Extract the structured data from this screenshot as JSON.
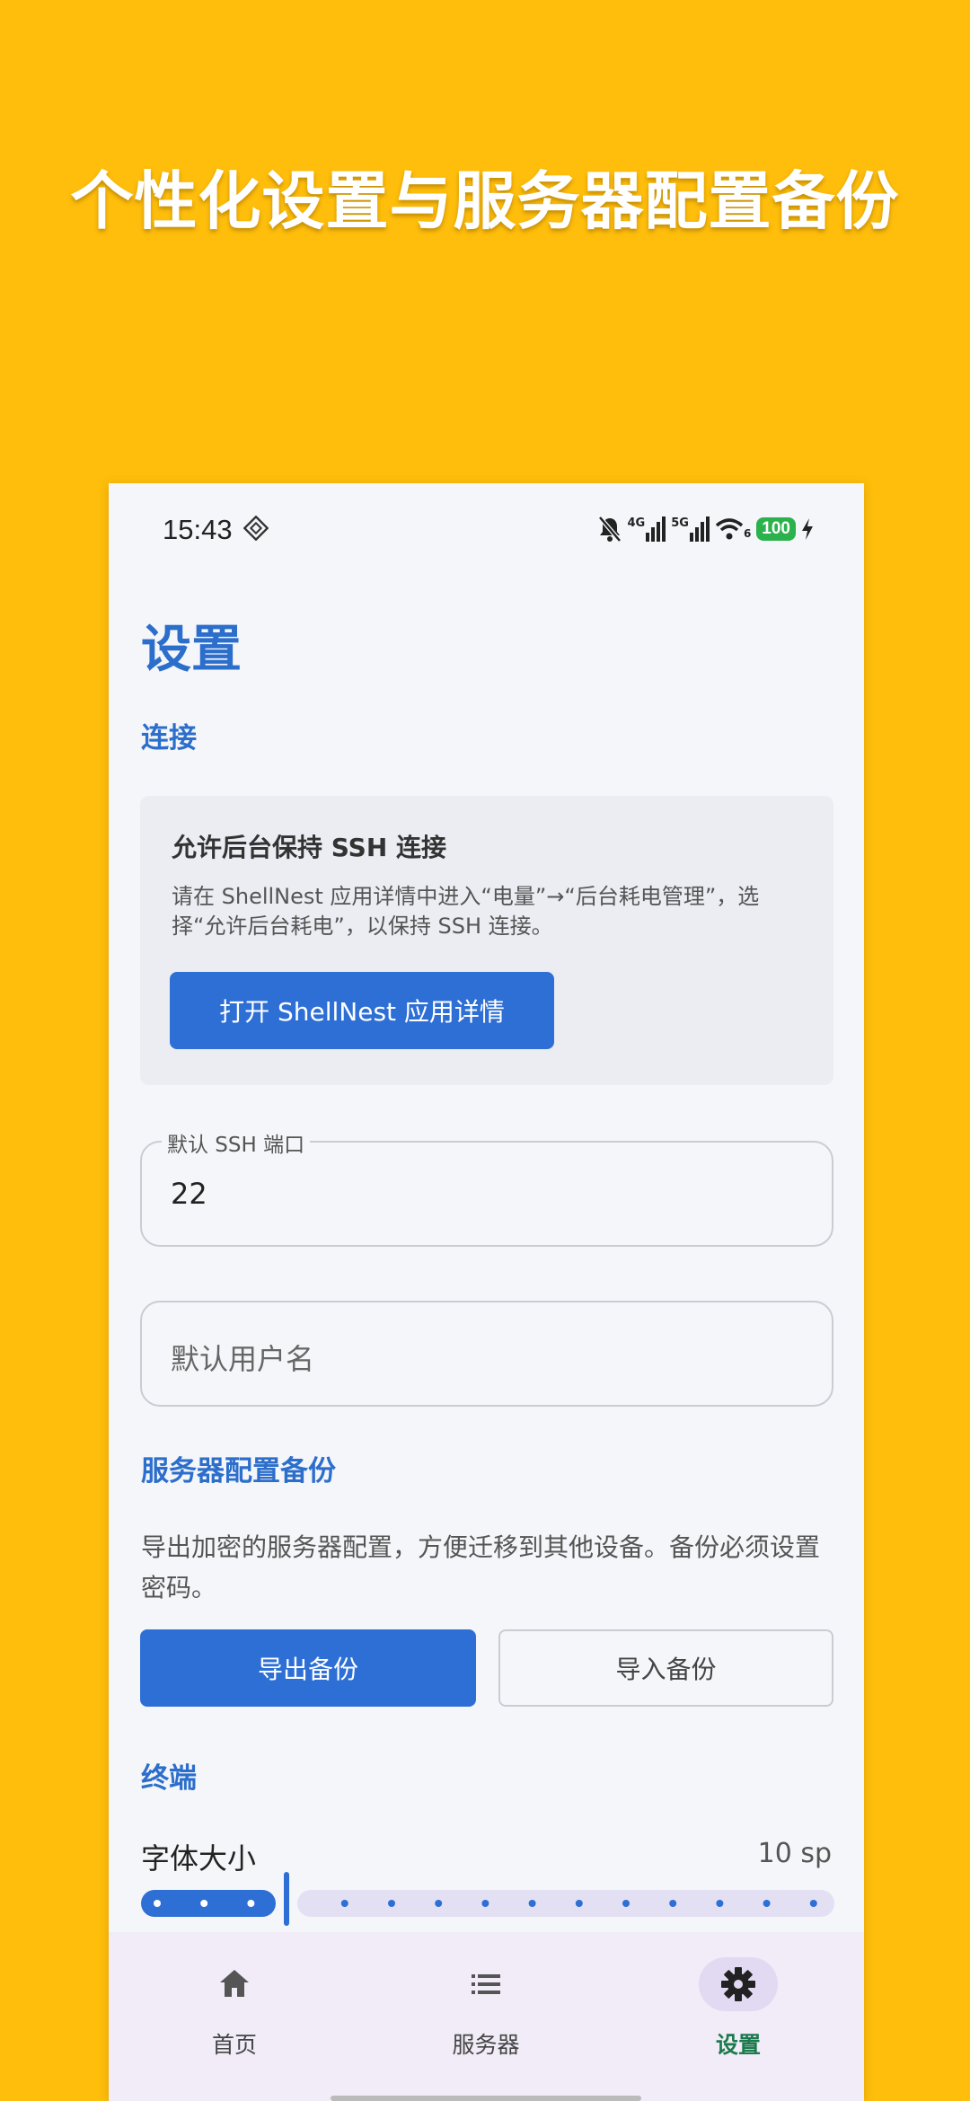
{
  "headline": "个性化设置与服务器配置备份",
  "status_bar": {
    "time": "15:43",
    "network_4g": "4G",
    "network_5g": "5G",
    "wifi_num": "6",
    "battery": "100"
  },
  "page_title": "设置",
  "sections": {
    "connection": "连接",
    "backup": "服务器配置备份",
    "terminal": "终端"
  },
  "card": {
    "title": "允许后台保持 SSH 连接",
    "description": "请在 ShellNest 应用详情中进入“电量”→“后台耗电管理”，选择“允许后台耗电”，以保持 SSH 连接。",
    "button": "打开 ShellNest 应用详情"
  },
  "fields": {
    "port_label": "默认 SSH 端口",
    "port_value": "22",
    "username_placeholder": "默认用户名"
  },
  "backup": {
    "description": "导出加密的服务器配置，方便迁移到其他设备。备份必须设置密码。",
    "export": "导出备份",
    "import": "导入备份"
  },
  "terminal": {
    "font_size_label": "字体大小",
    "font_size_value": "10 sp",
    "slider_fraction": 0.21
  },
  "nav": {
    "items": [
      {
        "label": "首页",
        "icon": "home-icon"
      },
      {
        "label": "服务器",
        "icon": "list-icon"
      },
      {
        "label": "设置",
        "icon": "gear-icon",
        "active": true
      }
    ]
  },
  "colors": {
    "background": "#FFBE0B",
    "accent": "#2C6ECB",
    "button": "#2E6FD6",
    "nav_active": "#1D7A4E"
  }
}
